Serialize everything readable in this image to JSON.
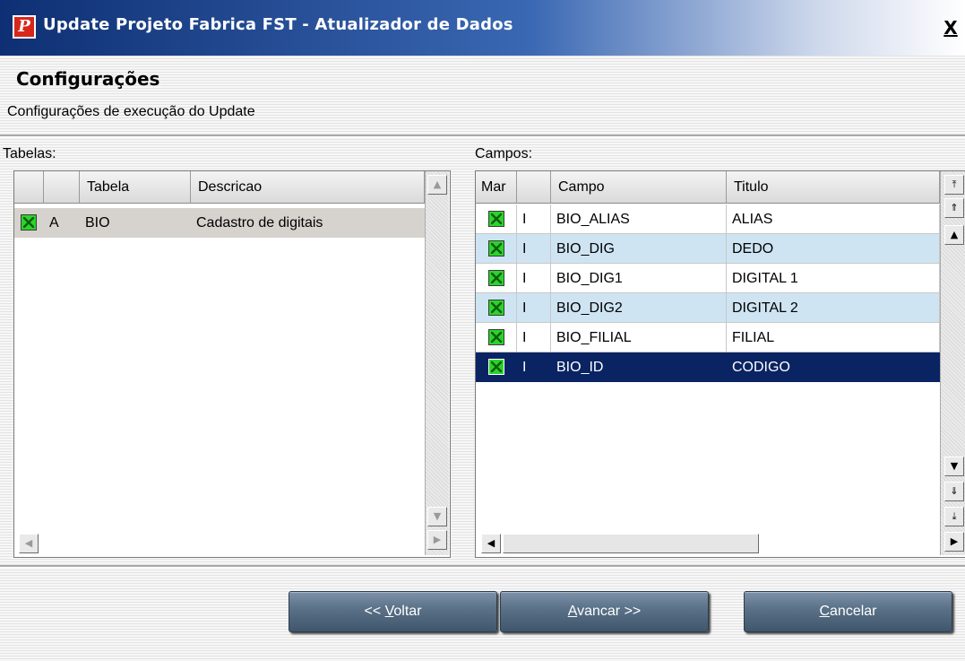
{
  "window": {
    "title": "Update Projeto Fabrica FST - Atualizador de Dados",
    "close_label": "X"
  },
  "page": {
    "heading": "Configurações",
    "subheading": "Configurações de execução do Update"
  },
  "tabelas": {
    "label": "Tabelas:",
    "columns": [
      "",
      "",
      "Tabela",
      "Descricao"
    ],
    "rows": [
      {
        "checked": true,
        "status": "A",
        "tabela": "BIO",
        "descricao": "Cadastro de digitais"
      }
    ]
  },
  "campos": {
    "label": "Campos:",
    "columns": [
      "Mar",
      "",
      "Campo",
      "Titulo"
    ],
    "rows": [
      {
        "checked": true,
        "op": "I",
        "campo": "BIO_ALIAS",
        "titulo": "ALIAS"
      },
      {
        "checked": true,
        "op": "I",
        "campo": "BIO_DIG",
        "titulo": "DEDO"
      },
      {
        "checked": true,
        "op": "I",
        "campo": "BIO_DIG1",
        "titulo": "DIGITAL 1"
      },
      {
        "checked": true,
        "op": "I",
        "campo": "BIO_DIG2",
        "titulo": "DIGITAL 2"
      },
      {
        "checked": true,
        "op": "I",
        "campo": "BIO_FILIAL",
        "titulo": "FILIAL"
      },
      {
        "checked": true,
        "op": "I",
        "campo": "BIO_ID",
        "titulo": "CODIGO"
      }
    ],
    "selected_row": "BIO_ID"
  },
  "buttons": {
    "voltar": {
      "prefix": "<< ",
      "mnemonic": "V",
      "rest": "oltar"
    },
    "avancar": {
      "mnemonic": "A",
      "rest": "vancar >>"
    },
    "cancelar": {
      "mnemonic": "C",
      "rest": "ancelar"
    }
  },
  "colors": {
    "selected_row": "#0a2463",
    "alt_row": "#cfe4f2",
    "first_row": "#d6d3ce",
    "button": "#4f667d"
  },
  "icons": [
    "app-logo-icon",
    "close-icon",
    "checkbox-checked-icon",
    "scroll-up-icon",
    "scroll-down-icon",
    "scroll-left-icon",
    "scroll-right-icon",
    "scroll-top-icon",
    "scroll-bottom-icon",
    "scroll-page-up-icon",
    "scroll-page-down-icon"
  ]
}
